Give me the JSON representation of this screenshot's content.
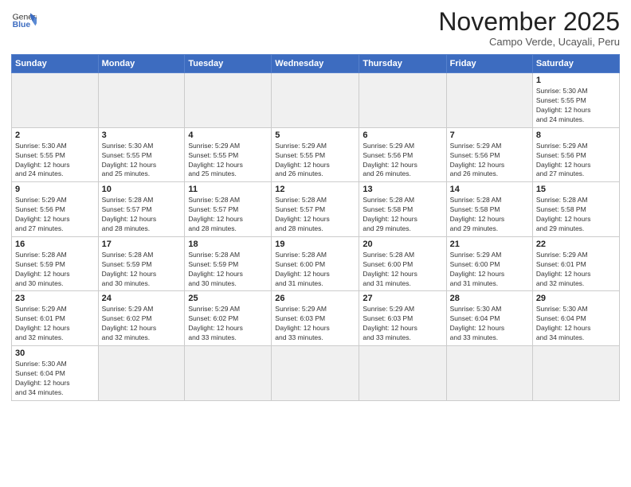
{
  "logo": {
    "text_general": "General",
    "text_blue": "Blue"
  },
  "title": "November 2025",
  "subtitle": "Campo Verde, Ucayali, Peru",
  "days_of_week": [
    "Sunday",
    "Monday",
    "Tuesday",
    "Wednesday",
    "Thursday",
    "Friday",
    "Saturday"
  ],
  "weeks": [
    [
      {
        "day": "",
        "info": ""
      },
      {
        "day": "",
        "info": ""
      },
      {
        "day": "",
        "info": ""
      },
      {
        "day": "",
        "info": ""
      },
      {
        "day": "",
        "info": ""
      },
      {
        "day": "",
        "info": ""
      },
      {
        "day": "1",
        "info": "Sunrise: 5:30 AM\nSunset: 5:55 PM\nDaylight: 12 hours\nand 24 minutes."
      }
    ],
    [
      {
        "day": "2",
        "info": "Sunrise: 5:30 AM\nSunset: 5:55 PM\nDaylight: 12 hours\nand 24 minutes."
      },
      {
        "day": "3",
        "info": "Sunrise: 5:30 AM\nSunset: 5:55 PM\nDaylight: 12 hours\nand 25 minutes."
      },
      {
        "day": "4",
        "info": "Sunrise: 5:29 AM\nSunset: 5:55 PM\nDaylight: 12 hours\nand 25 minutes."
      },
      {
        "day": "5",
        "info": "Sunrise: 5:29 AM\nSunset: 5:55 PM\nDaylight: 12 hours\nand 26 minutes."
      },
      {
        "day": "6",
        "info": "Sunrise: 5:29 AM\nSunset: 5:56 PM\nDaylight: 12 hours\nand 26 minutes."
      },
      {
        "day": "7",
        "info": "Sunrise: 5:29 AM\nSunset: 5:56 PM\nDaylight: 12 hours\nand 26 minutes."
      },
      {
        "day": "8",
        "info": "Sunrise: 5:29 AM\nSunset: 5:56 PM\nDaylight: 12 hours\nand 27 minutes."
      }
    ],
    [
      {
        "day": "9",
        "info": "Sunrise: 5:29 AM\nSunset: 5:56 PM\nDaylight: 12 hours\nand 27 minutes."
      },
      {
        "day": "10",
        "info": "Sunrise: 5:28 AM\nSunset: 5:57 PM\nDaylight: 12 hours\nand 28 minutes."
      },
      {
        "day": "11",
        "info": "Sunrise: 5:28 AM\nSunset: 5:57 PM\nDaylight: 12 hours\nand 28 minutes."
      },
      {
        "day": "12",
        "info": "Sunrise: 5:28 AM\nSunset: 5:57 PM\nDaylight: 12 hours\nand 28 minutes."
      },
      {
        "day": "13",
        "info": "Sunrise: 5:28 AM\nSunset: 5:58 PM\nDaylight: 12 hours\nand 29 minutes."
      },
      {
        "day": "14",
        "info": "Sunrise: 5:28 AM\nSunset: 5:58 PM\nDaylight: 12 hours\nand 29 minutes."
      },
      {
        "day": "15",
        "info": "Sunrise: 5:28 AM\nSunset: 5:58 PM\nDaylight: 12 hours\nand 29 minutes."
      }
    ],
    [
      {
        "day": "16",
        "info": "Sunrise: 5:28 AM\nSunset: 5:59 PM\nDaylight: 12 hours\nand 30 minutes."
      },
      {
        "day": "17",
        "info": "Sunrise: 5:28 AM\nSunset: 5:59 PM\nDaylight: 12 hours\nand 30 minutes."
      },
      {
        "day": "18",
        "info": "Sunrise: 5:28 AM\nSunset: 5:59 PM\nDaylight: 12 hours\nand 30 minutes."
      },
      {
        "day": "19",
        "info": "Sunrise: 5:28 AM\nSunset: 6:00 PM\nDaylight: 12 hours\nand 31 minutes."
      },
      {
        "day": "20",
        "info": "Sunrise: 5:28 AM\nSunset: 6:00 PM\nDaylight: 12 hours\nand 31 minutes."
      },
      {
        "day": "21",
        "info": "Sunrise: 5:29 AM\nSunset: 6:00 PM\nDaylight: 12 hours\nand 31 minutes."
      },
      {
        "day": "22",
        "info": "Sunrise: 5:29 AM\nSunset: 6:01 PM\nDaylight: 12 hours\nand 32 minutes."
      }
    ],
    [
      {
        "day": "23",
        "info": "Sunrise: 5:29 AM\nSunset: 6:01 PM\nDaylight: 12 hours\nand 32 minutes."
      },
      {
        "day": "24",
        "info": "Sunrise: 5:29 AM\nSunset: 6:02 PM\nDaylight: 12 hours\nand 32 minutes."
      },
      {
        "day": "25",
        "info": "Sunrise: 5:29 AM\nSunset: 6:02 PM\nDaylight: 12 hours\nand 33 minutes."
      },
      {
        "day": "26",
        "info": "Sunrise: 5:29 AM\nSunset: 6:03 PM\nDaylight: 12 hours\nand 33 minutes."
      },
      {
        "day": "27",
        "info": "Sunrise: 5:29 AM\nSunset: 6:03 PM\nDaylight: 12 hours\nand 33 minutes."
      },
      {
        "day": "28",
        "info": "Sunrise: 5:30 AM\nSunset: 6:04 PM\nDaylight: 12 hours\nand 33 minutes."
      },
      {
        "day": "29",
        "info": "Sunrise: 5:30 AM\nSunset: 6:04 PM\nDaylight: 12 hours\nand 34 minutes."
      }
    ],
    [
      {
        "day": "30",
        "info": "Sunrise: 5:30 AM\nSunset: 6:04 PM\nDaylight: 12 hours\nand 34 minutes."
      },
      {
        "day": "",
        "info": ""
      },
      {
        "day": "",
        "info": ""
      },
      {
        "day": "",
        "info": ""
      },
      {
        "day": "",
        "info": ""
      },
      {
        "day": "",
        "info": ""
      },
      {
        "day": "",
        "info": ""
      }
    ]
  ]
}
